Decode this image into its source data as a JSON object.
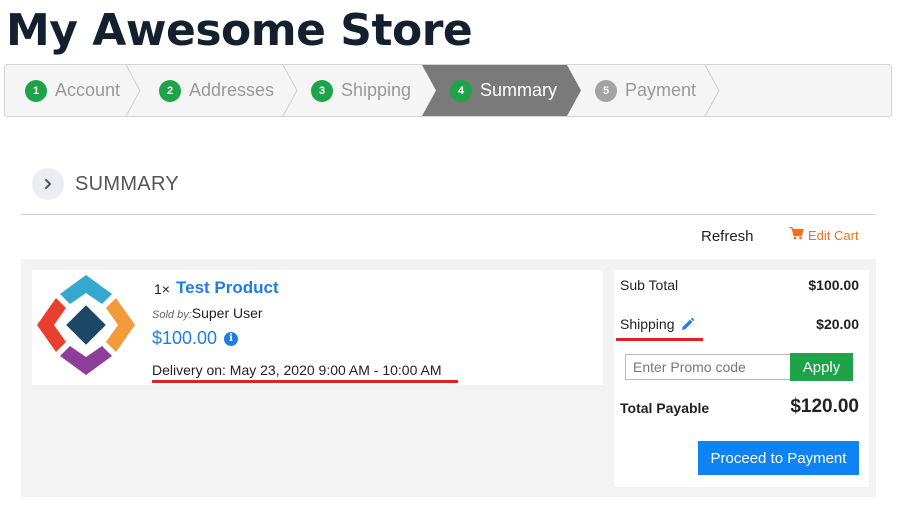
{
  "store": {
    "title": "My Awesome Store"
  },
  "steps": [
    {
      "num": "1",
      "label": "Account",
      "state": "done"
    },
    {
      "num": "2",
      "label": "Addresses",
      "state": "done"
    },
    {
      "num": "3",
      "label": "Shipping",
      "state": "done"
    },
    {
      "num": "4",
      "label": "Summary",
      "state": "active"
    },
    {
      "num": "5",
      "label": "Payment",
      "state": "pending"
    }
  ],
  "colors": {
    "step_done": "#1ea34b",
    "step_active_bg": "#7a7a7a",
    "step_pending": "#a3a3a3",
    "link_blue": "#1f7ee6",
    "edit_orange": "#f07020",
    "annotation_red": "#e51f1f",
    "apply_green": "#1ea34b",
    "proceed_blue": "#0f83f4"
  },
  "summary": {
    "title": "SUMMARY"
  },
  "actions": {
    "refresh": "Refresh",
    "edit_cart": "Edit Cart"
  },
  "item": {
    "qty": "1×",
    "name": "Test Product",
    "sold_by_label": "Sold by:",
    "sold_by": "Super User",
    "price": "$100.00",
    "delivery": "Delivery on: May 23, 2020 9:00 AM - 10:00 AM"
  },
  "totals": {
    "subtotal_label": "Sub Total",
    "subtotal": "$100.00",
    "shipping_label": "Shipping",
    "shipping": "$20.00",
    "promo_placeholder": "Enter Promo code",
    "apply": "Apply",
    "total_label": "Total Payable",
    "total": "$120.00",
    "proceed": "Proceed to Payment"
  },
  "icons": {
    "cart": "cart-icon",
    "pencil": "pencil-icon",
    "info": "info-icon",
    "chevron": "chevron-right-icon"
  }
}
